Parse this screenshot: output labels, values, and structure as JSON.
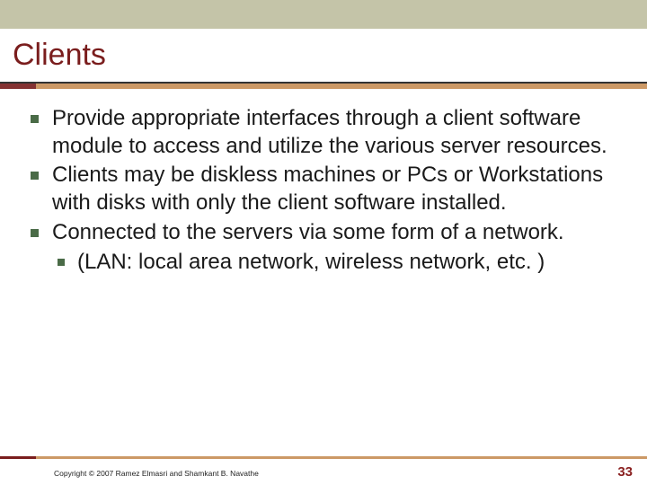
{
  "title": "Clients",
  "bullets": [
    {
      "text": "Provide appropriate interfaces through a client software module to access and utilize the various server resources."
    },
    {
      "text": "Clients may be diskless machines or PCs or Workstations with disks with only the client software installed."
    },
    {
      "text": "Connected to the servers via some form of a network.",
      "sub": [
        {
          "text": "(LAN: local area network, wireless network, etc. )"
        }
      ]
    }
  ],
  "footer": {
    "copyright": "Copyright © 2007 Ramez Elmasri and Shamkant B. Navathe",
    "page_number": "33"
  }
}
